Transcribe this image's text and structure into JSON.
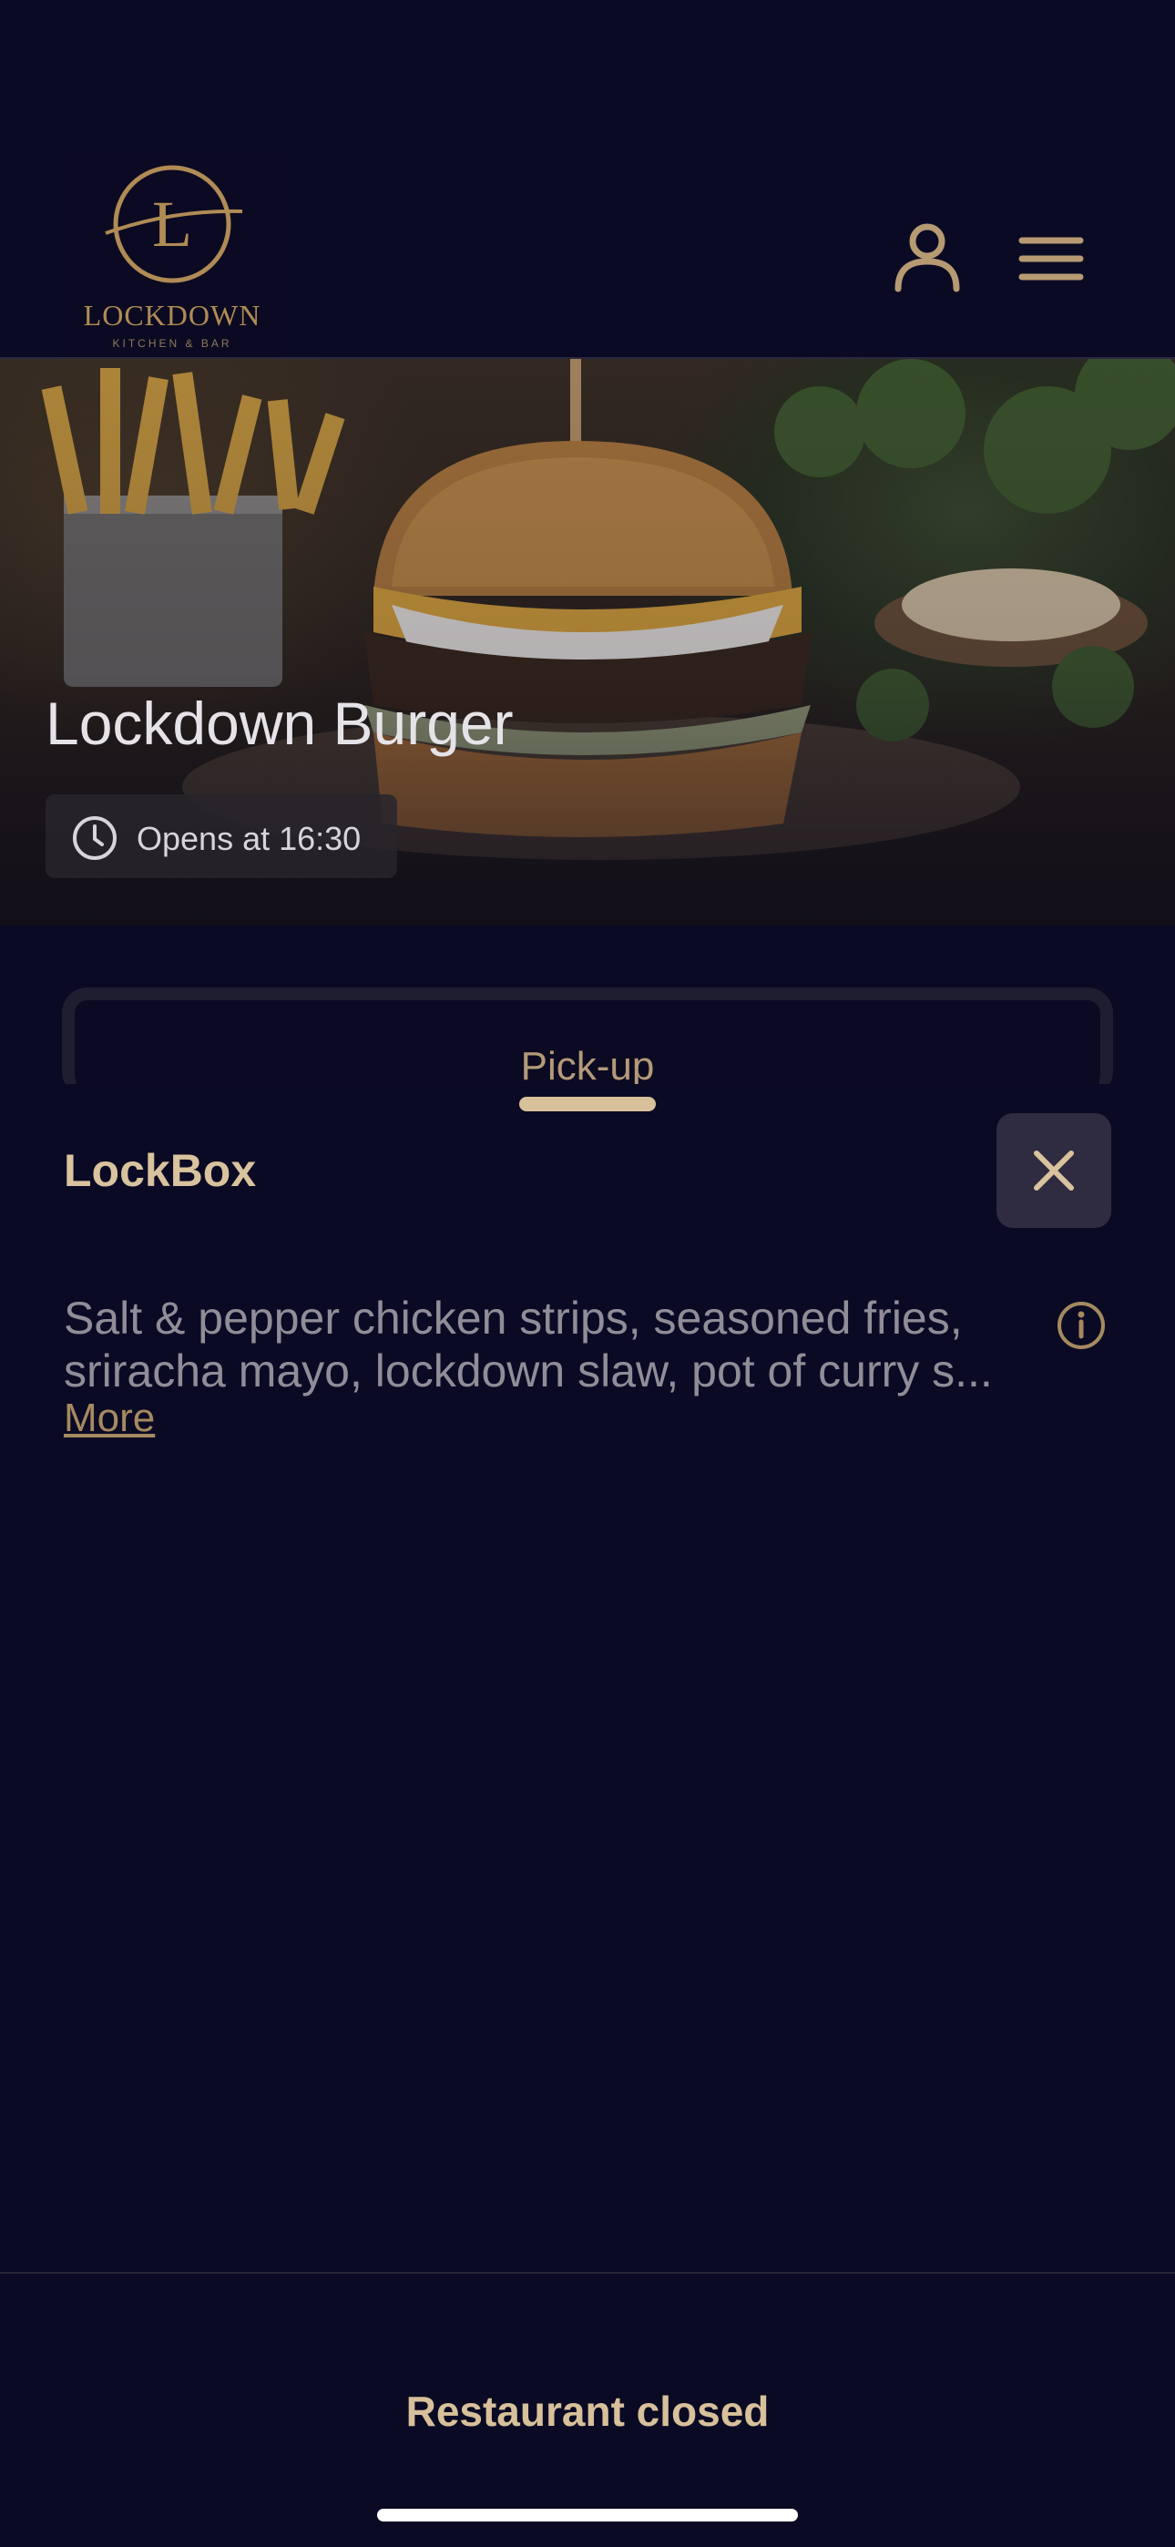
{
  "brand": {
    "logo_letter": "L",
    "logo_name": "LOCKDOWN",
    "logo_sub": "KITCHEN & BAR",
    "accent_color": "#b08b55"
  },
  "header": {
    "icons": [
      "user-icon",
      "menu-icon"
    ]
  },
  "hero": {
    "title": "Lockdown Burger",
    "hours": "Opens at 16:30",
    "hours_icon": "clock-icon"
  },
  "tabs": {
    "active_label": "Pick-up"
  },
  "sheet": {
    "title": "LockBox",
    "close_icon": "close-icon",
    "description_line1": "Salt & pepper chicken strips, seasoned fries,",
    "description_line2": "sriracha mayo, lockdown slaw, pot of curry s...",
    "more_label": "More",
    "info_icon": "info-icon"
  },
  "footer": {
    "status": "Restaurant closed"
  }
}
